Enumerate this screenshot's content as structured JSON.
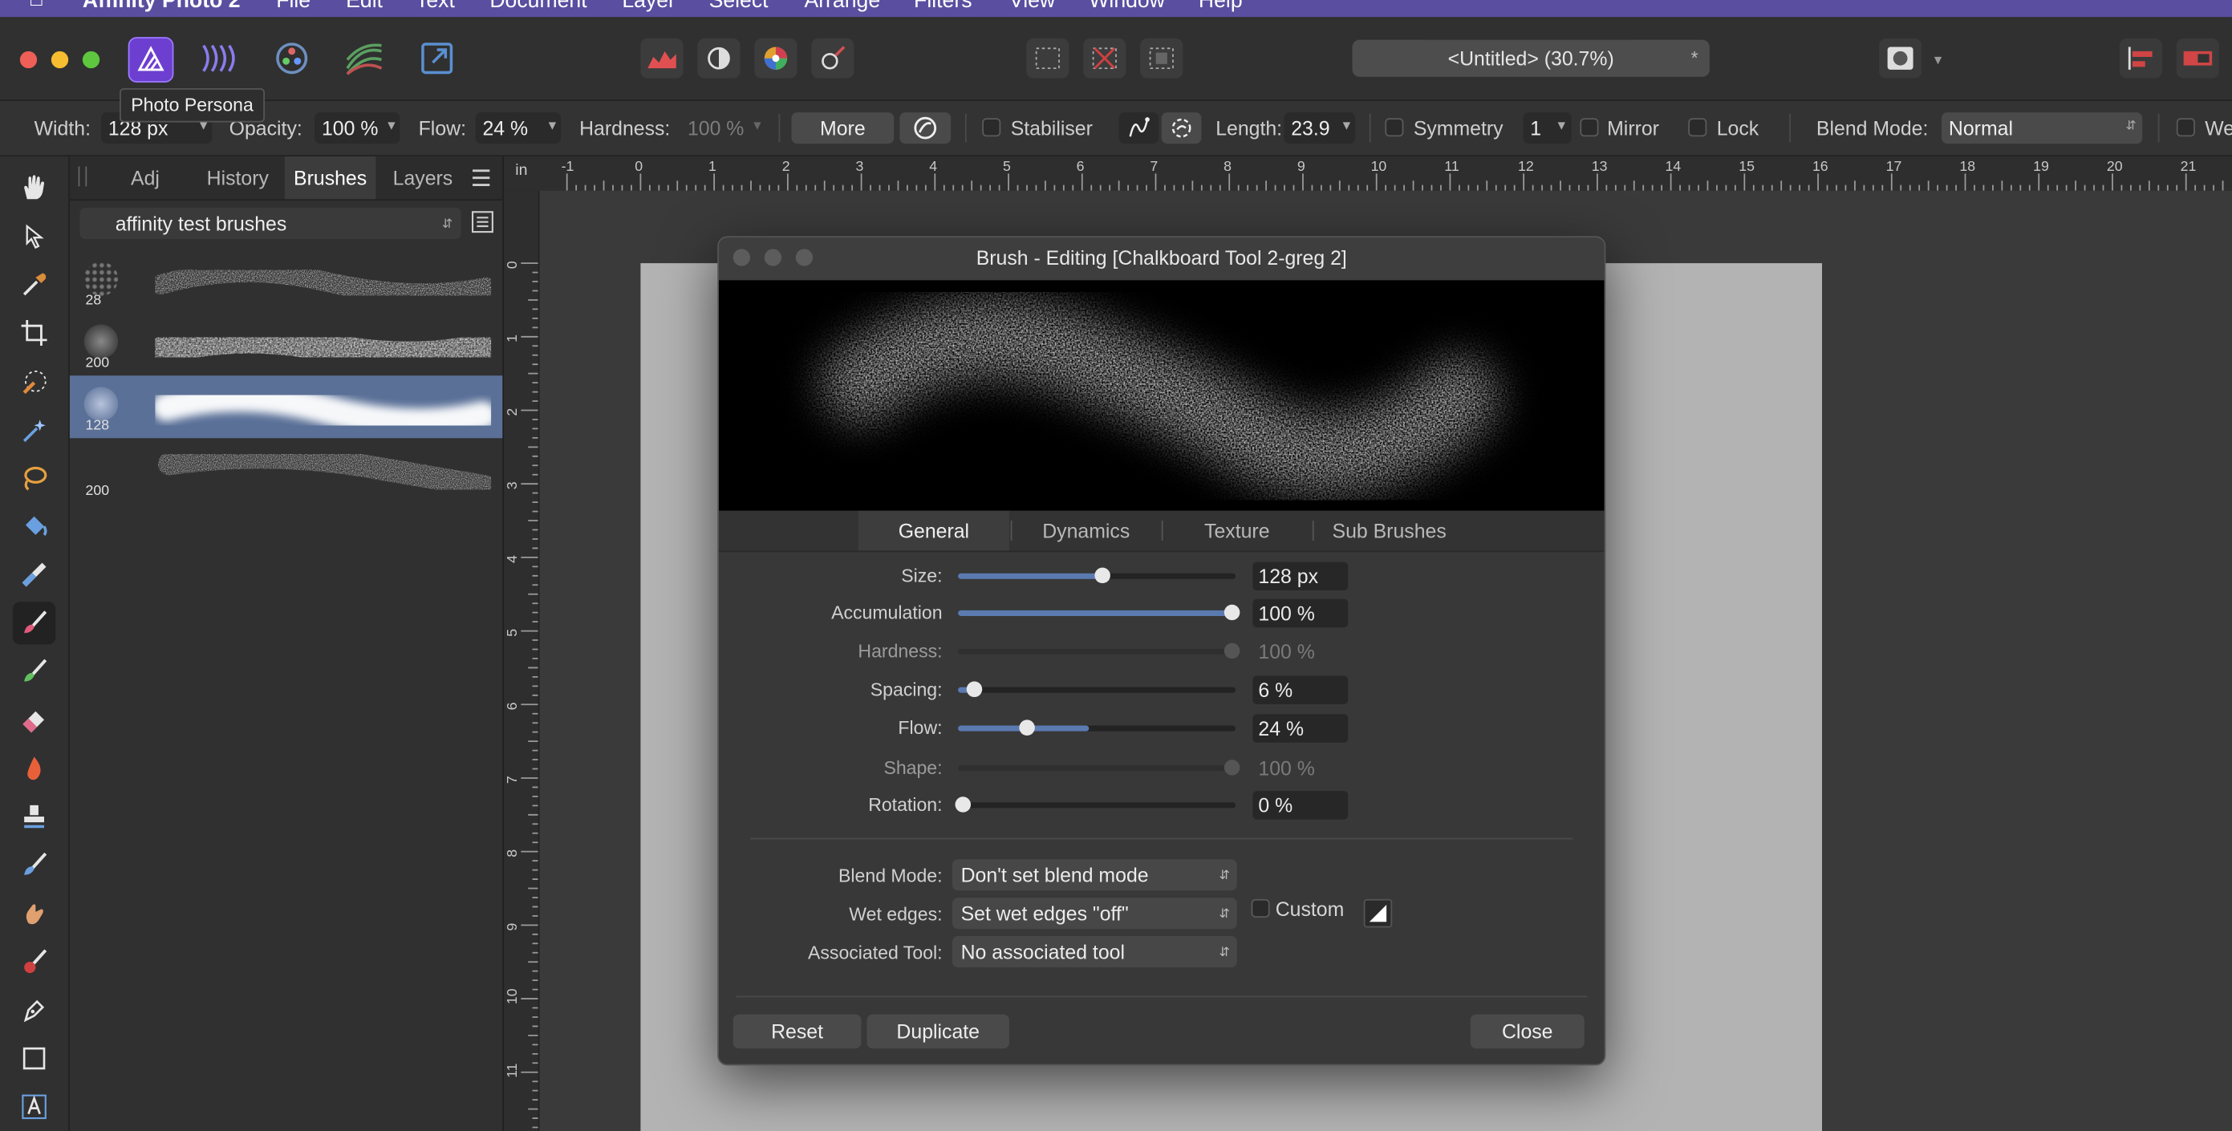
{
  "menubar": {
    "app_name": "Affinity Photo 2",
    "items": [
      "File",
      "Edit",
      "Text",
      "Document",
      "Layer",
      "Select",
      "Arrange",
      "Filters",
      "View",
      "Window",
      "Help"
    ]
  },
  "titlebar": {
    "document_title": "<Untitled> (30.7%)",
    "modified_mark": "*",
    "tooltip": "Photo Persona",
    "personas": [
      "photo-persona-icon",
      "liquify-persona-icon",
      "develop-persona-icon",
      "tone-mapping-persona-icon",
      "export-persona-icon"
    ]
  },
  "context_toolbar": {
    "width_label": "Width:",
    "width_value": "128 px",
    "opacity_label": "Opacity:",
    "opacity_value": "100 %",
    "flow_label": "Flow:",
    "flow_value": "24 %",
    "hardness_label": "Hardness:",
    "hardness_value": "100 %",
    "more_label": "More",
    "stabiliser_label": "Stabiliser",
    "length_label": "Length:",
    "length_value": "23.9",
    "symmetry_label": "Symmetry",
    "symmetry_value": "1",
    "mirror_label": "Mirror",
    "lock_label": "Lock",
    "blend_mode_label": "Blend Mode:",
    "blend_mode_value": "Normal",
    "wet_edges_label": "We"
  },
  "panel": {
    "tabs": [
      "Adj",
      "History",
      "Brushes",
      "Layers"
    ],
    "active_tab": "Brushes",
    "category": "affinity test brushes",
    "brushes": [
      {
        "size": "28",
        "selected": false
      },
      {
        "size": "200",
        "selected": false
      },
      {
        "size": "128",
        "selected": true
      },
      {
        "size": "200",
        "selected": false
      }
    ]
  },
  "ruler": {
    "unit": "in",
    "top_ticks": [
      "-1",
      "0",
      "1",
      "2",
      "3",
      "4",
      "5",
      "6",
      "7",
      "8",
      "9",
      "10",
      "11",
      "12",
      "13",
      "14",
      "15",
      "16",
      "17",
      "18",
      "19",
      "20",
      "21"
    ],
    "left_ticks": [
      "0",
      "1",
      "2",
      "3",
      "4",
      "5",
      "6",
      "7",
      "8",
      "9",
      "10",
      "11"
    ]
  },
  "dialog": {
    "title": "Brush - Editing [Chalkboard Tool 2-greg 2]",
    "tabs": [
      "General",
      "Dynamics",
      "Texture",
      "Sub Brushes"
    ],
    "active_tab": "General",
    "params": [
      {
        "label": "Size:",
        "value": "128 px",
        "level": 0.52,
        "enabled": true
      },
      {
        "label": "Accumulation",
        "value": "100 %",
        "level": 1.0,
        "enabled": true
      },
      {
        "label": "Hardness:",
        "value": "100 %",
        "level": 1.0,
        "enabled": false
      },
      {
        "label": "Spacing:",
        "value": "6 %",
        "level": 0.04,
        "enabled": true
      },
      {
        "label": "Flow:",
        "value": "24 %",
        "level": 0.24,
        "range_fill": 0.47,
        "enabled": true
      },
      {
        "label": "Shape:",
        "value": "100 %",
        "level": 1.0,
        "enabled": false
      },
      {
        "label": "Rotation:",
        "value": "0 %",
        "level": 0.0,
        "enabled": true
      }
    ],
    "blend_mode_label": "Blend Mode:",
    "blend_mode_value": "Don't set blend mode",
    "wet_edges_label": "Wet edges:",
    "wet_edges_value": "Set wet edges \"off\"",
    "custom_label": "Custom",
    "associated_tool_label": "Associated Tool:",
    "associated_tool_value": "No associated tool",
    "reset_label": "Reset",
    "duplicate_label": "Duplicate",
    "close_label": "Close"
  },
  "colors": {
    "accent": "#5a7ab0",
    "selected_row": "#5a7097",
    "menubar": "#5a4ea0"
  },
  "tools": [
    "hand-tool-icon",
    "move-tool-icon",
    "color-picker-tool-icon",
    "crop-tool-icon",
    "selection-brush-tool-icon",
    "flood-select-tool-icon",
    "freehand-selection-tool-icon",
    "flood-fill-tool-icon",
    "gradient-tool-icon",
    "paint-brush-tool-icon",
    "color-replacement-tool-icon",
    "erase-brush-tool-icon",
    "dodge-brush-tool-icon",
    "clone-brush-tool-icon",
    "healing-brush-tool-icon",
    "smudge-brush-tool-icon",
    "red-eye-tool-icon",
    "pen-tool-icon",
    "rectangle-tool-icon",
    "artistic-text-tool-icon"
  ]
}
